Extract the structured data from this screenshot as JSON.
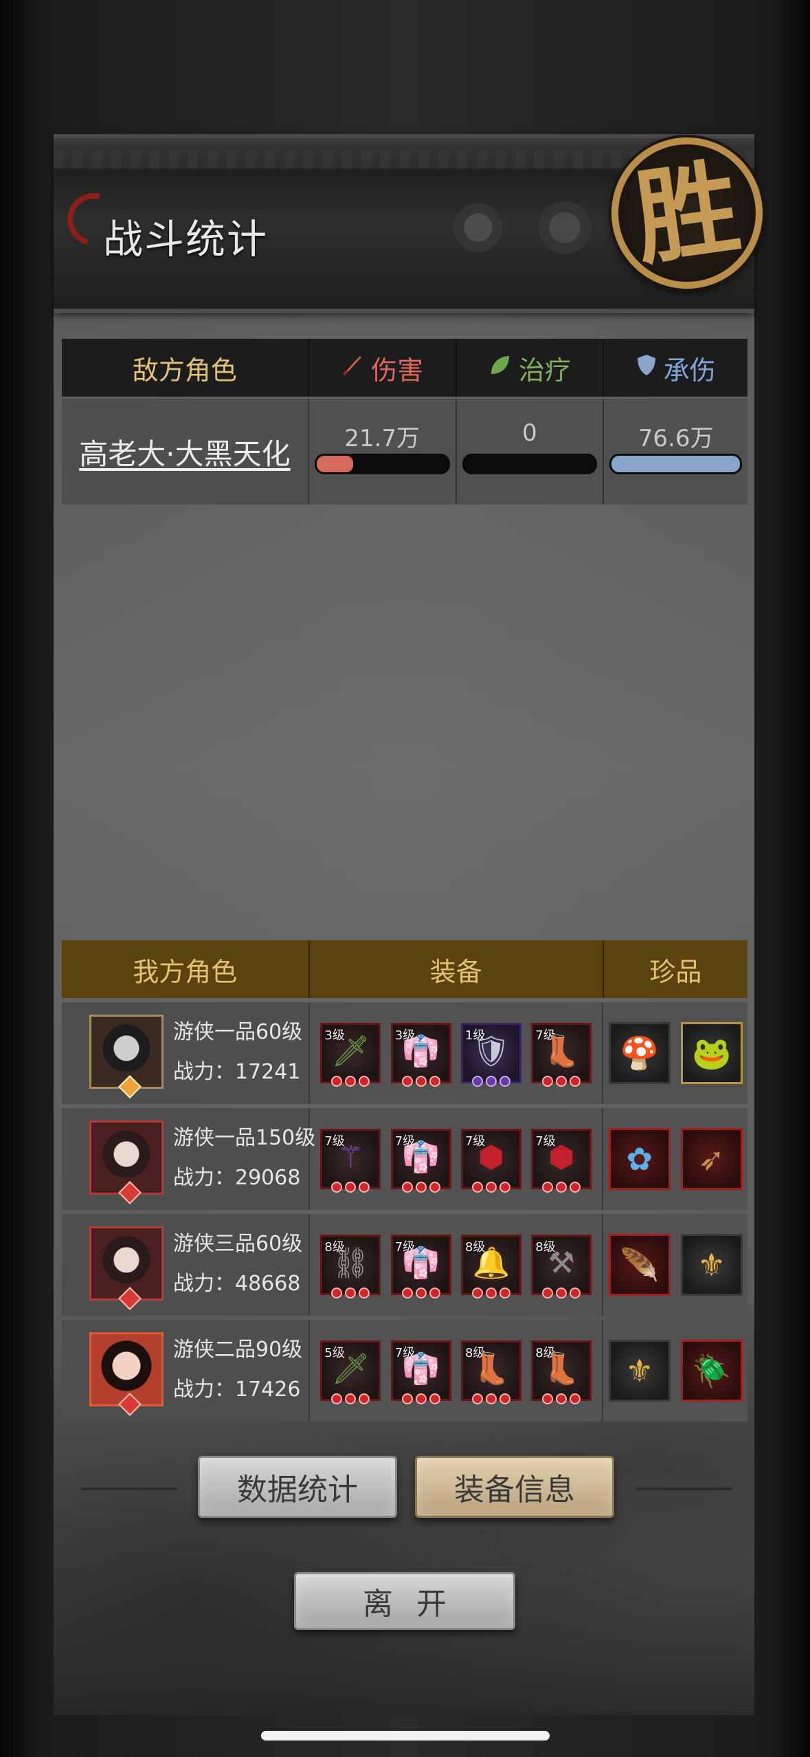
{
  "header": {
    "title": "战斗统计",
    "result_seal": "胜"
  },
  "enemy_table": {
    "headers": {
      "role": "敌方角色",
      "damage": "伤害",
      "heal": "治疗",
      "taken": "承伤"
    },
    "rows": [
      {
        "name": "高老大·大黑天化",
        "damage": "21.7万",
        "damage_ratio": 0.28,
        "heal": "0",
        "heal_ratio": 0,
        "taken": "76.6万",
        "taken_ratio": 1.0
      }
    ]
  },
  "ally_table": {
    "headers": {
      "role": "我方角色",
      "equipment": "装备",
      "treasure": "珍品"
    },
    "rows": [
      {
        "title": "游侠一品60级",
        "power_label": "战力：",
        "power": "17241",
        "equipment": [
          {
            "level": "3级",
            "icon": "sword-icon"
          },
          {
            "level": "3级",
            "icon": "robe-icon"
          },
          {
            "level": "1级",
            "icon": "cloak-icon"
          },
          {
            "level": "7级",
            "icon": "boots-icon"
          }
        ],
        "treasures": [
          {
            "icon": "lingzhi-icon"
          },
          {
            "icon": "jade-beast-icon"
          }
        ]
      },
      {
        "title": "游侠一品150级",
        "power_label": "战力：",
        "power": "29068",
        "equipment": [
          {
            "level": "7级",
            "icon": "whip-icon"
          },
          {
            "level": "7级",
            "icon": "robe-icon"
          },
          {
            "level": "7级",
            "icon": "jewel-icon"
          },
          {
            "level": "7级",
            "icon": "jewel-icon"
          }
        ],
        "treasures": [
          {
            "icon": "lotus-icon"
          },
          {
            "icon": "arrows-icon"
          }
        ]
      },
      {
        "title": "游侠三品60级",
        "power_label": "战力：",
        "power": "48668",
        "equipment": [
          {
            "level": "8级",
            "icon": "chain-icon"
          },
          {
            "level": "7级",
            "icon": "robe-icon"
          },
          {
            "level": "8级",
            "icon": "bell-icon"
          },
          {
            "level": "8级",
            "icon": "mace-icon"
          }
        ],
        "treasures": [
          {
            "icon": "fan-icon"
          },
          {
            "icon": "gold-staff-icon"
          }
        ]
      },
      {
        "title": "游侠二品90级",
        "power_label": "战力：",
        "power": "17426",
        "equipment": [
          {
            "level": "5级",
            "icon": "sword-icon"
          },
          {
            "level": "7级",
            "icon": "robe-icon"
          },
          {
            "level": "8级",
            "icon": "boots-icon"
          },
          {
            "level": "8级",
            "icon": "boots-icon"
          }
        ],
        "treasures": [
          {
            "icon": "gold-staff-icon"
          },
          {
            "icon": "scarab-icon"
          }
        ]
      }
    ]
  },
  "buttons": {
    "stats": "数据统计",
    "equip_info": "装备信息",
    "leave": "离开"
  },
  "colors": {
    "damage": "#d66a5e",
    "heal": "#6fa84e",
    "taken": "#8aa4cc",
    "gold_text": "#e4c274",
    "ally_header": "#5b4310"
  }
}
